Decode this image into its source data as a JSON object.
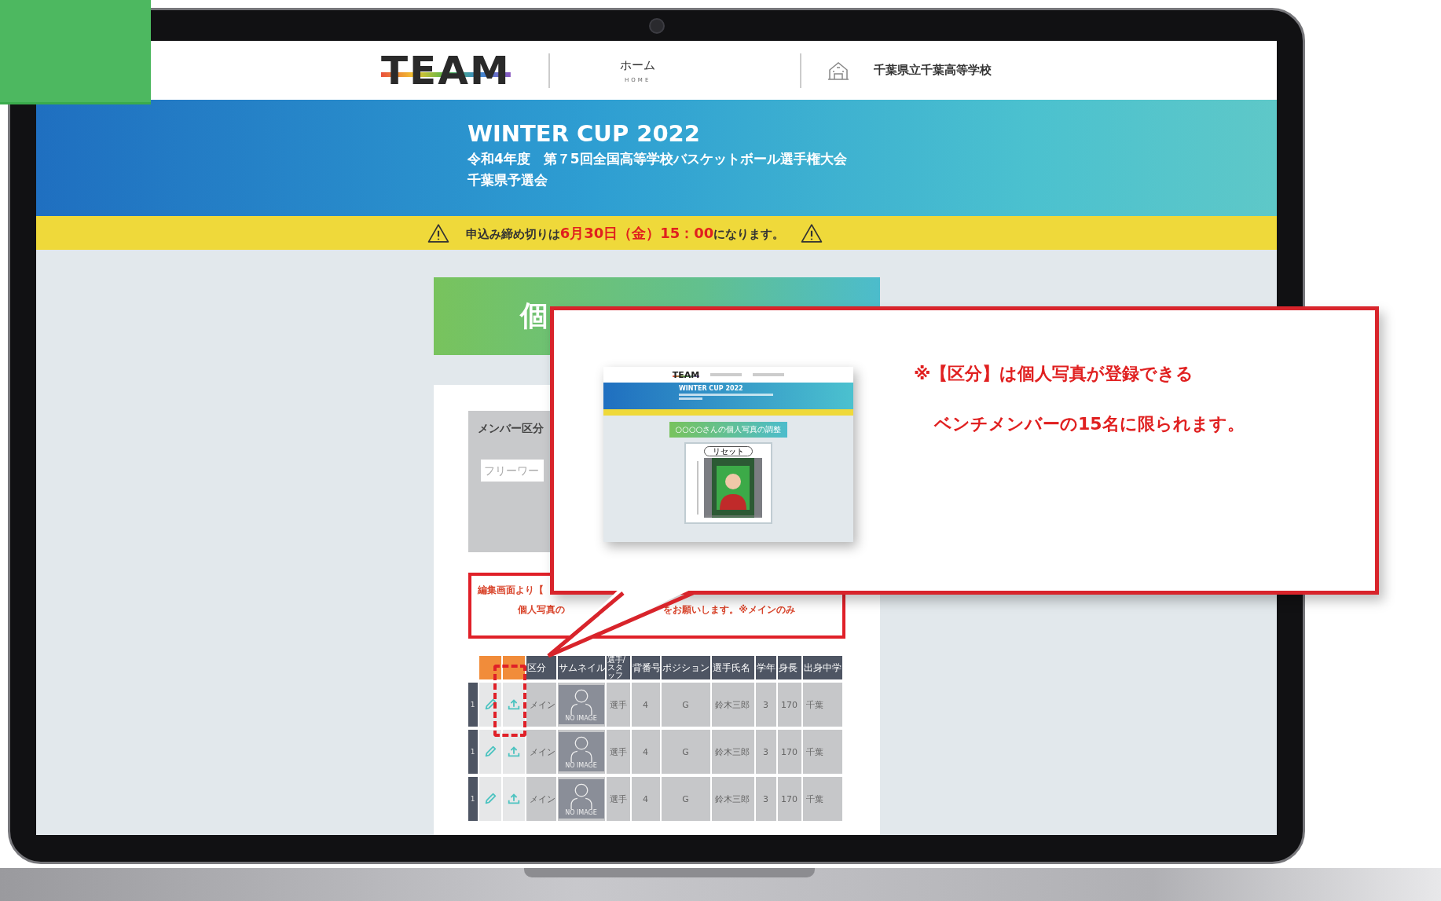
{
  "header": {
    "logo": "TEAM",
    "nav": [
      {
        "label": "ホーム",
        "sublabel": "HOME"
      }
    ],
    "school": "千葉県立千葉高等学校"
  },
  "banner": {
    "title": "WINTER CUP 2022",
    "lines": [
      "令和4年度　第７5回全国高等学校バスケットボール選手権大会",
      "千葉県予選会"
    ]
  },
  "deadline": "申込み締め切りは**6月30日（金）15：00**になります。",
  "page_title": "個",
  "filter": {
    "label": "メンバー区分",
    "placeholder": "フリーワー"
  },
  "notice": {
    "lines": [
      [
        "編集画面より【"
      ],
      [
        "個人写真の",
        "をお願いします。※メインのみ"
      ]
    ]
  },
  "table": {
    "columns": [
      {
        "kind": "accent"
      },
      {
        "kind": "accent"
      },
      {
        "kind": "text",
        "label": "区分"
      },
      {
        "kind": "text",
        "label": "サムネイル"
      },
      {
        "kind": "text",
        "label": "選手/スタッフ"
      },
      {
        "kind": "text",
        "label": "背番号"
      },
      {
        "kind": "text",
        "label": "ポジション"
      },
      {
        "kind": "text",
        "label": "選手氏名"
      },
      {
        "kind": "text",
        "label": "学年"
      },
      {
        "kind": "text",
        "label": "身長"
      },
      {
        "kind": "text",
        "label": "出身中学"
      }
    ],
    "rows": [
      {
        "index": "1",
        "cells": [
          {
            "kind": "edit"
          },
          {
            "kind": "upload"
          },
          {
            "kind": "text",
            "text": "メイン"
          },
          {
            "kind": "thumbnail",
            "text": "NO IMAGE"
          },
          {
            "kind": "text",
            "text": "選手"
          },
          {
            "kind": "text",
            "text": "4"
          },
          {
            "kind": "text",
            "text": "G"
          },
          {
            "kind": "text",
            "text": "鈴木三郎"
          },
          {
            "kind": "text",
            "text": "3"
          },
          {
            "kind": "text",
            "text": "170"
          },
          {
            "kind": "text",
            "text": "千葉"
          }
        ]
      },
      {
        "index": "1",
        "cells": [
          {
            "kind": "edit"
          },
          {
            "kind": "upload"
          },
          {
            "kind": "text",
            "text": "メイン"
          },
          {
            "kind": "thumbnail",
            "text": "NO IMAGE"
          },
          {
            "kind": "text",
            "text": "選手"
          },
          {
            "kind": "text",
            "text": "4"
          },
          {
            "kind": "text",
            "text": "G"
          },
          {
            "kind": "text",
            "text": "鈴木三郎"
          },
          {
            "kind": "text",
            "text": "3"
          },
          {
            "kind": "text",
            "text": "170"
          },
          {
            "kind": "text",
            "text": "千葉"
          }
        ]
      },
      {
        "index": "1",
        "cells": [
          {
            "kind": "edit"
          },
          {
            "kind": "upload"
          },
          {
            "kind": "text",
            "text": "メイン"
          },
          {
            "kind": "thumbnail",
            "text": "NO IMAGE"
          },
          {
            "kind": "text",
            "text": "選手"
          },
          {
            "kind": "text",
            "text": "4"
          },
          {
            "kind": "text",
            "text": "G"
          },
          {
            "kind": "text",
            "text": "鈴木三郎"
          },
          {
            "kind": "text",
            "text": "3"
          },
          {
            "kind": "text",
            "text": "170"
          },
          {
            "kind": "text",
            "text": "千葉"
          }
        ]
      }
    ]
  },
  "callout": {
    "note_lines": [
      "※【区分】は個人写真が登録できる",
      "ベンチメンバーの15名に限られます。"
    ],
    "preview": {
      "logo": "TEAM",
      "title": "WINTER CUP 2022",
      "button": "○○○○さんの個人写真の調整",
      "reset": "リセット"
    }
  }
}
